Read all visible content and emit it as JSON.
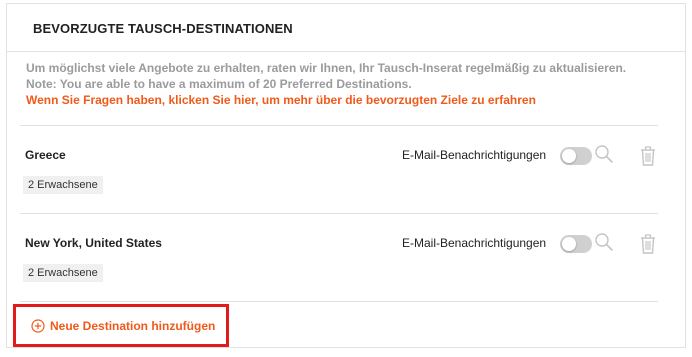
{
  "panel": {
    "title": "BEVORZUGTE TAUSCH-DESTINATIONEN"
  },
  "info": {
    "line1": "Um möglichst viele Angebote zu erhalten, raten wir Ihnen, Ihr Tausch-Inserat regelmäßig zu aktualisieren.",
    "line2": "Note: You are able to have a maximum of 20 Preferred Destinations.",
    "link": "Wenn Sie Fragen haben, klicken Sie hier, um mehr über die bevorzugten Ziele zu erfahren"
  },
  "destinations": [
    {
      "name": "Greece",
      "guests": "2 Erwachsene",
      "notification_label": "E-Mail-Benachrichtigungen",
      "notifications_on": false
    },
    {
      "name": "New York, United States",
      "guests": "2 Erwachsene",
      "notification_label": "E-Mail-Benachrichtigungen",
      "notifications_on": false
    }
  ],
  "add_button": {
    "label": "Neue Destination hinzufügen",
    "icon": "plus-circle-icon"
  },
  "colors": {
    "accent": "#f05a1a",
    "highlight_border": "#e11b1b",
    "muted_text": "#9b9b9b",
    "toggle_off": "#d0d0d0"
  }
}
